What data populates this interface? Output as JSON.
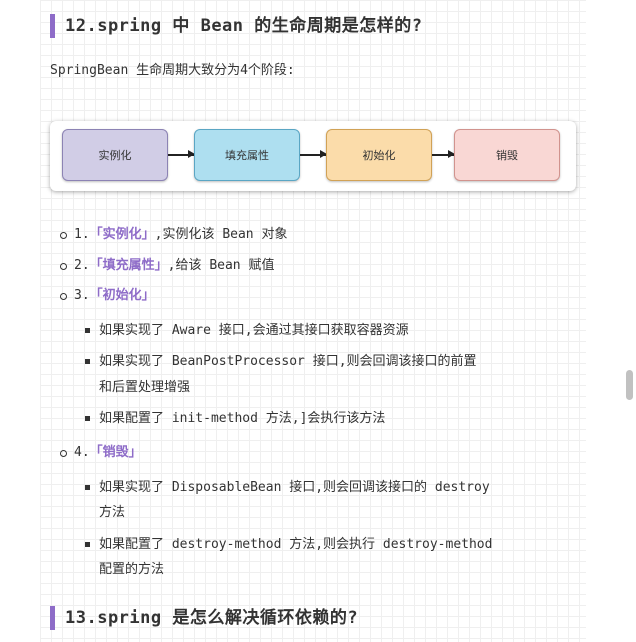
{
  "heading1": "12.spring 中 Bean 的生命周期是怎样的?",
  "intro": "SpringBean 生命周期大致分为4个阶段:",
  "diagram": {
    "stages": [
      "实例化",
      "填充属性",
      "初始化",
      "销毁"
    ],
    "colors": {
      "stage1_fill": "#d1cde6",
      "stage1_border": "#8c83b4",
      "stage2_fill": "#aedff0",
      "stage2_border": "#5ba6c4",
      "stage3_fill": "#fbdcaa",
      "stage3_border": "#d1a256",
      "stage4_fill": "#f9d7d4",
      "stage4_border": "#d1938e"
    }
  },
  "items": [
    {
      "num": "1.",
      "tag": "「实例化」",
      "text": ",实例化该 Bean 对象"
    },
    {
      "num": "2.",
      "tag": "「填充属性」",
      "text": ",给该 Bean 赋值"
    },
    {
      "num": "3.",
      "tag": "「初始化」",
      "text": ""
    },
    {
      "num": "4.",
      "tag": "「销毁」",
      "text": ""
    }
  ],
  "init_subs": {
    "s1": "如果实现了 Aware 接口,会通过其接口获取容器资源",
    "s2_line1": "如果实现了 BeanPostProcessor 接口,则会回调该接口的前置",
    "s2_line2": "和后置处理增强",
    "s3": "如果配置了 init-method 方法,]会执行该方法"
  },
  "destroy_subs": {
    "s1_line1": "如果实现了 DisposableBean 接口,则会回调该接口的 destroy",
    "s1_line2": "方法",
    "s2_line1": "如果配置了 destroy-method 方法,则会执行 destroy-method",
    "s2_line2": "配置的方法"
  },
  "heading2": "13.spring 是怎么解决循环依赖的?",
  "accent_color": "#8e6cc8"
}
